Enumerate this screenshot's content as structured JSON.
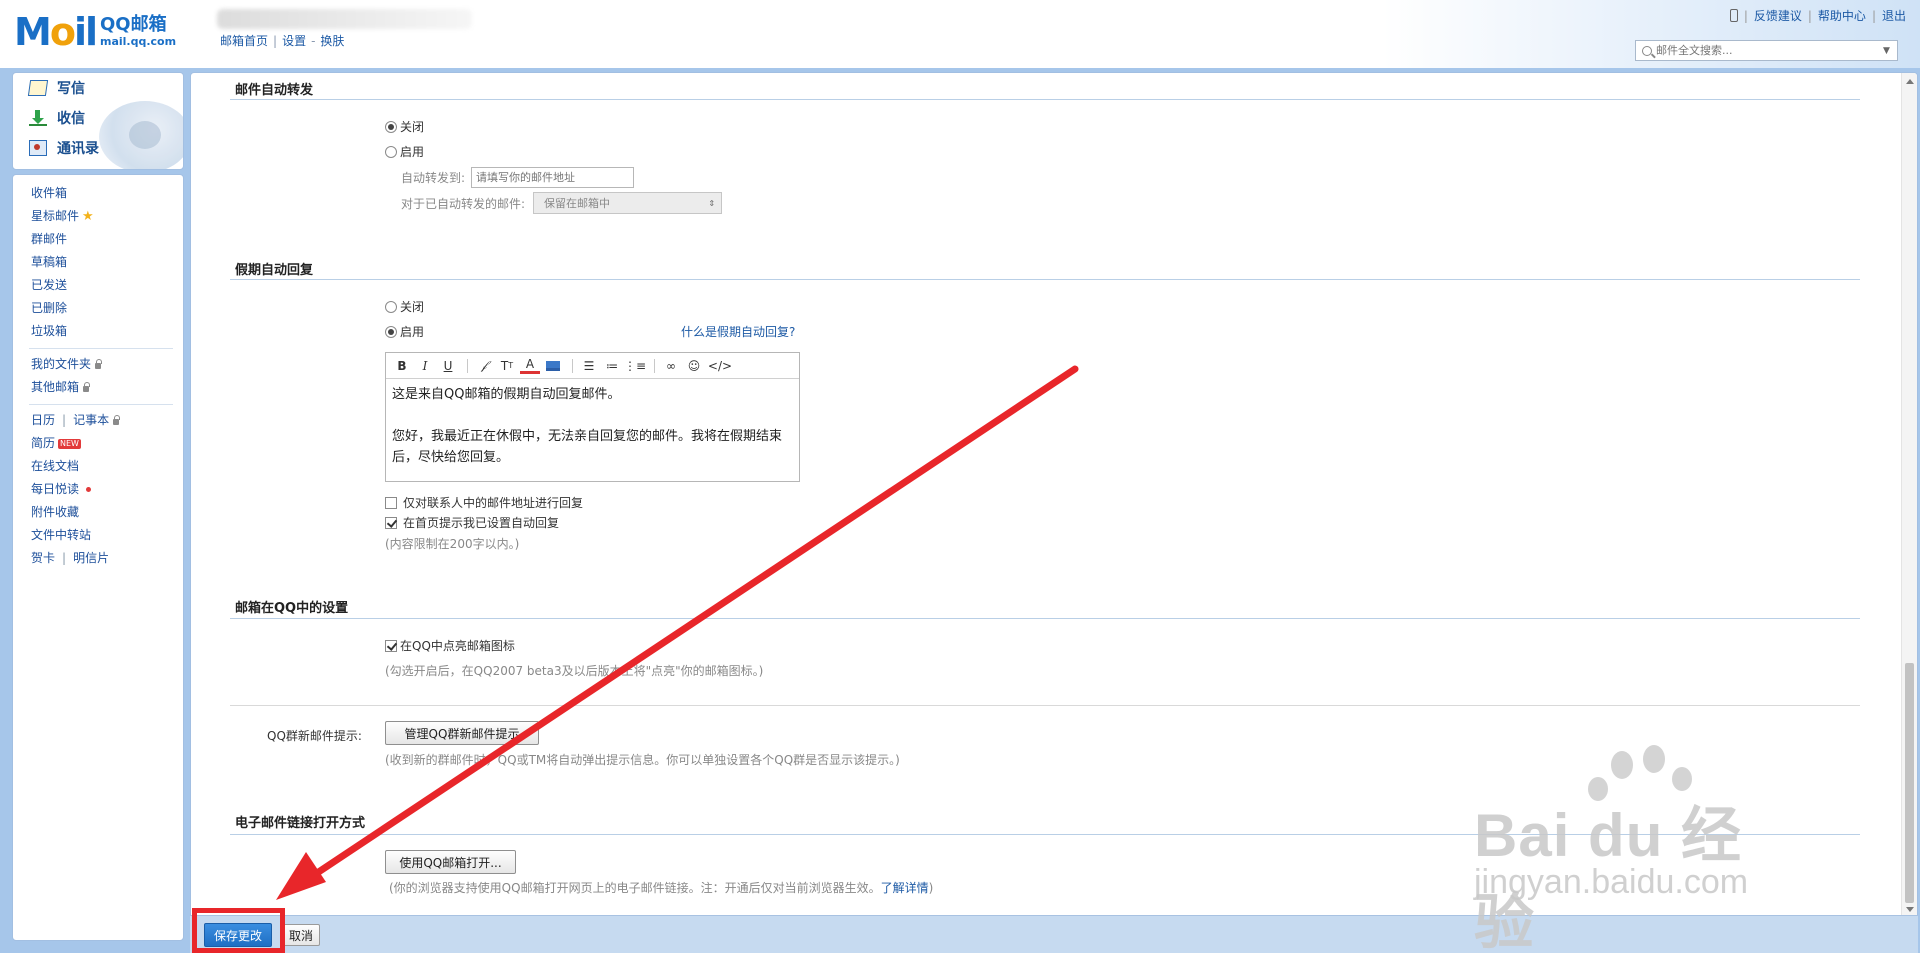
{
  "header": {
    "logo_mail": "Mail",
    "logo_cn": "QQ邮箱",
    "logo_domain": "mail.qq.com",
    "links": [
      "邮箱首页",
      "设置",
      "换肤"
    ],
    "right_links": [
      "反馈建议",
      "帮助中心",
      "退出"
    ],
    "search_placeholder": "邮件全文搜索..."
  },
  "sidebar": {
    "quick": [
      {
        "label": "写信",
        "icon": "compose-icon"
      },
      {
        "label": "收信",
        "icon": "inbox-download-icon"
      },
      {
        "label": "通讯录",
        "icon": "contacts-icon"
      }
    ],
    "folders": [
      "收件箱",
      "星标邮件",
      "群邮件",
      "草稿箱",
      "已发送",
      "已删除",
      "垃圾箱"
    ],
    "my_folders": "我的文件夹",
    "other_mailbox": "其他邮箱",
    "calendar": "日历",
    "notepad": "记事本",
    "resume": "简历",
    "new_badge": "NEW",
    "online_docs": "在线文档",
    "daily_reading": "每日悦读",
    "attachments": "附件收藏",
    "file_transfer": "文件中转站",
    "greeting_card": "贺卡",
    "postcard": "明信片"
  },
  "forward": {
    "title": "邮件自动转发",
    "off": "关闭",
    "on": "启用",
    "selected": "off",
    "to_label": "自动转发到:",
    "to_placeholder": "请填写你的邮件地址",
    "after_label": "对于已自动转发的邮件:",
    "after_value": "保留在邮箱中"
  },
  "vacation": {
    "title": "假期自动回复",
    "off": "关闭",
    "on": "启用",
    "selected": "on",
    "help_link": "什么是假期自动回复?",
    "body_line1": "这是来自QQ邮箱的假期自动回复邮件。",
    "body_line2": "您好，我最近正在休假中，无法亲自回复您的邮件。我将在假期结束后，尽快给您回复。",
    "opt_contacts_only": "仅对联系人中的邮件地址进行回复",
    "opt_contacts_only_checked": false,
    "opt_homepage_hint": "在首页提示我已设置自动回复",
    "opt_homepage_hint_checked": true,
    "limit_note": "(内容限制在200字以内。)"
  },
  "qq": {
    "title": "邮箱在QQ中的设置",
    "light_icon": "在QQ中点亮邮箱图标",
    "light_icon_checked": true,
    "light_icon_note": "(勾选开启后，在QQ2007 beta3及以后版本上将\"点亮\"你的邮箱图标。)",
    "group_label": "QQ群新邮件提示:",
    "group_button": "管理QQ群新邮件提示",
    "group_note": "(收到新的群邮件时，QQ或TM将自动弹出提示信息。你可以单独设置各个QQ群是否显示该提示。)"
  },
  "link_open": {
    "title": "电子邮件链接打开方式",
    "button": "使用QQ邮箱打开...",
    "note": "(你的浏览器支持使用QQ邮箱打开网页上的电子邮件链接。注：开通后仅对当前浏览器生效。",
    "note_link": "了解详情",
    "note_end": ")"
  },
  "footer": {
    "save": "保存更改",
    "cancel": "取消"
  },
  "watermark": {
    "big": "Bai du 经验",
    "small": "jingyan.baidu.com"
  },
  "colors": {
    "frame": "#a6c6ea",
    "brand": "#1a6fc6",
    "link": "#1d5aa5",
    "annotation_red": "#e8262a",
    "save_button": "#2a7dd2"
  }
}
